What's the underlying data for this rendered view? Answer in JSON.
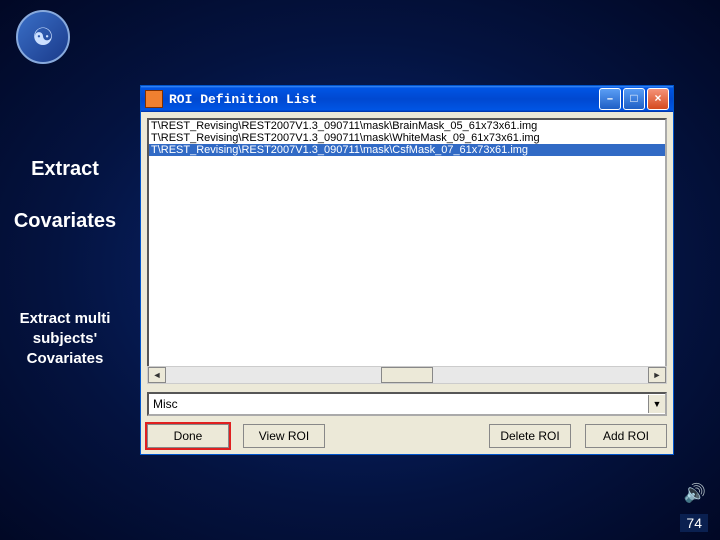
{
  "sidebar": {
    "line1": "Extract",
    "line2": "Covariates",
    "sub1": "Extract multi",
    "sub2": "subjects'",
    "sub3": "Covariates"
  },
  "window": {
    "title": "ROI Definition List",
    "list": {
      "items": [
        "T\\REST_Revising\\REST2007V1.3_090711\\mask\\BrainMask_05_61x73x61.img",
        "T\\REST_Revising\\REST2007V1.3_090711\\mask\\WhiteMask_09_61x73x61.img",
        "T\\REST_Revising\\REST2007V1.3_090711\\mask\\CsfMask_07_61x73x61.img"
      ],
      "selected_index": 2
    },
    "combo": {
      "value": "Misc"
    },
    "buttons": {
      "done": "Done",
      "view": "View ROI",
      "del": "Delete ROI",
      "add": "Add ROI"
    },
    "controls": {
      "min": "–",
      "max": "□",
      "close": "×"
    }
  },
  "page": {
    "num": "74"
  }
}
